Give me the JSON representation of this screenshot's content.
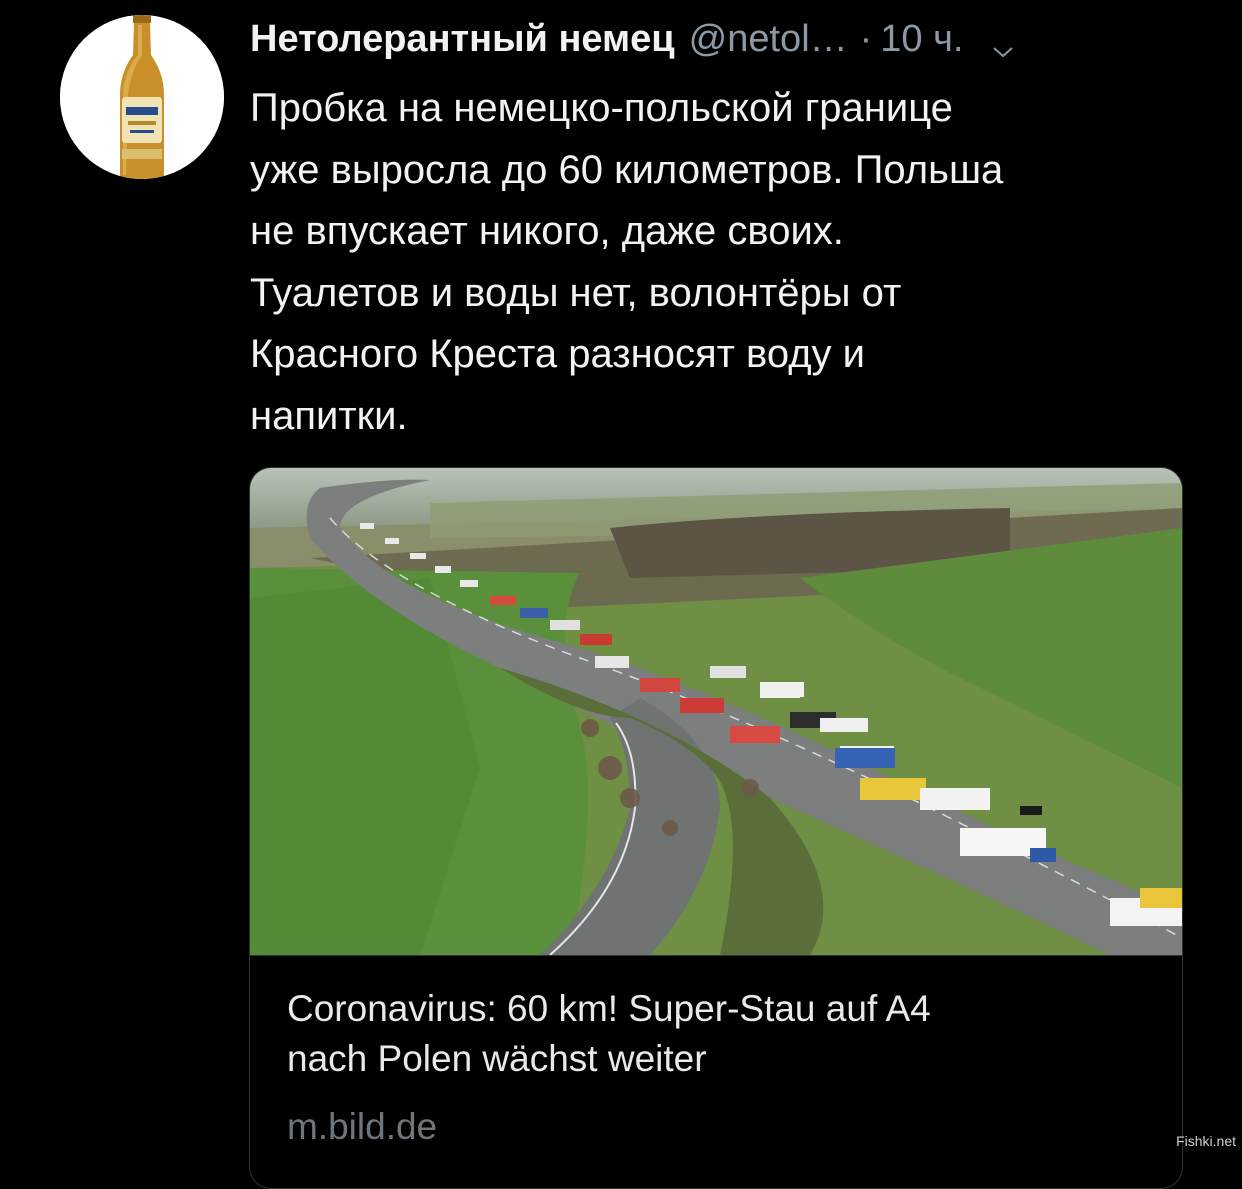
{
  "tweet": {
    "author": {
      "display_name": "Нетолерантный немец",
      "handle": "@netol…",
      "avatar_icon": "beer-bottle-icon"
    },
    "separator": "·",
    "time": "10 ч.",
    "menu_icon": "chevron-down-icon",
    "text_lines": [
      "Пробка на немецко-польской границе",
      "уже выросла до 60 километров. Польша",
      "не впускает никого, даже своих.",
      "Туалетов и воды нет, волонтёры от",
      "Красного Креста разносят воду и",
      "напитки."
    ],
    "link_card": {
      "image_alt": "Aerial photo of a long truck queue on a highway between green fields",
      "title_lines": [
        "Coronavirus: 60 km! Super-Stau auf A4",
        "nach Polen wächst weiter"
      ],
      "domain": "m.bild.de"
    }
  },
  "watermark": "Fishki.net",
  "colors": {
    "background": "#000000",
    "text": "#f2f2f2",
    "muted": "#8b98a5",
    "card_border": "#2f3336",
    "domain": "#6e767d"
  }
}
